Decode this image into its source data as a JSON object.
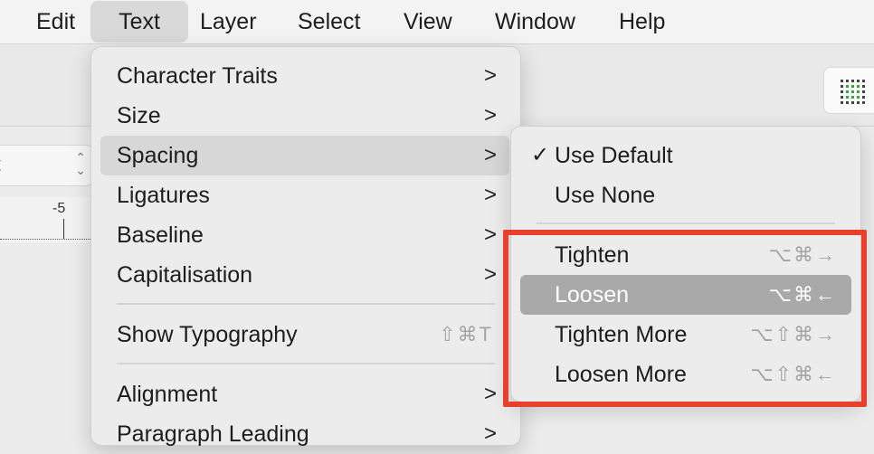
{
  "menubar": {
    "items": [
      "Edit",
      "Text",
      "Layer",
      "Select",
      "View",
      "Window",
      "Help"
    ],
    "active": "Text"
  },
  "toolbar": {
    "font_field_text": "t",
    "stepper_glyph": "⌃⌄",
    "ruler_label": "-5",
    "grid_icon": "grid-icon"
  },
  "text_menu": {
    "items": [
      {
        "label": "Character Traits",
        "chevron": ">"
      },
      {
        "label": "Size",
        "chevron": ">"
      },
      {
        "label": "Spacing",
        "chevron": ">"
      },
      {
        "label": "Ligatures",
        "chevron": ">"
      },
      {
        "label": "Baseline",
        "chevron": ">"
      },
      {
        "label": "Capitalisation",
        "chevron": ">"
      },
      {
        "label": "Show Typography",
        "shortcut": "⇧⌘T"
      },
      {
        "label": "Alignment",
        "chevron": ">"
      },
      {
        "label": "Paragraph Leading",
        "chevron": ">"
      }
    ],
    "highlighted": "Spacing"
  },
  "spacing_submenu": {
    "items": [
      {
        "label": "Use Default",
        "checked": "✓"
      },
      {
        "label": "Use None"
      },
      {
        "label": "Tighten",
        "shortcut": "⌥⌘→"
      },
      {
        "label": "Loosen",
        "shortcut": "⌥⌘←"
      },
      {
        "label": "Tighten More",
        "shortcut": "⌥⇧⌘→"
      },
      {
        "label": "Loosen More",
        "shortcut": "⌥⇧⌘←"
      }
    ],
    "highlighted": "Loosen"
  },
  "colors": {
    "annotation_box": "#e8402a",
    "submenu_highlight": "#a9a9a9",
    "menu_highlight": "#d7d7d7"
  }
}
